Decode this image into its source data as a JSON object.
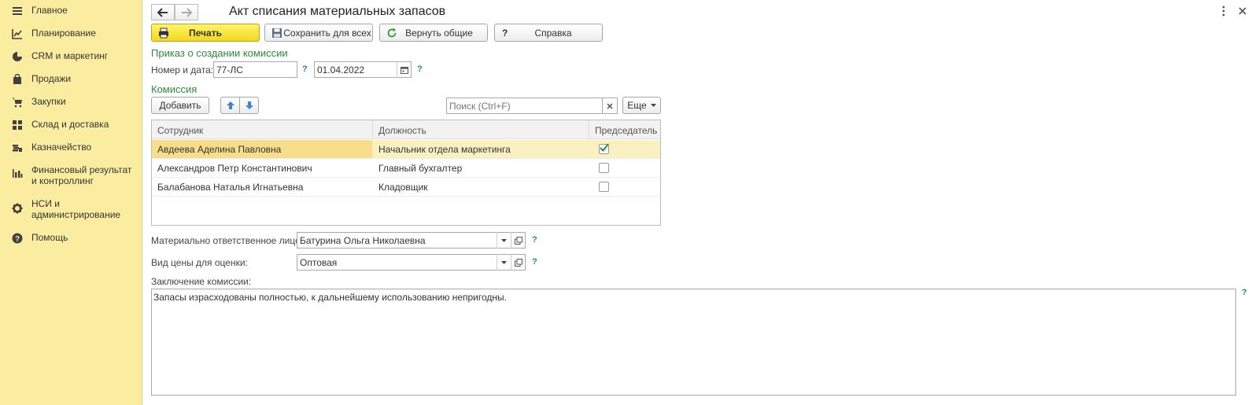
{
  "sidebar": {
    "items": [
      {
        "label": "Главное",
        "icon": "menu-icon"
      },
      {
        "label": "Планирование",
        "icon": "chart-line-icon"
      },
      {
        "label": "CRM и маркетинг",
        "icon": "pie-icon"
      },
      {
        "label": "Продажи",
        "icon": "bag-icon"
      },
      {
        "label": "Закупки",
        "icon": "cart-icon"
      },
      {
        "label": "Склад и доставка",
        "icon": "grid-icon"
      },
      {
        "label": "Казначейство",
        "icon": "coins-icon"
      },
      {
        "label": "Финансовый результат и контроллинг",
        "icon": "bar-chart-icon"
      },
      {
        "label": "НСИ и администрирование",
        "icon": "gear-icon"
      },
      {
        "label": "Помощь",
        "icon": "help-icon"
      }
    ]
  },
  "header": {
    "title": "Акт списания материальных запасов",
    "more_icon": "more-vertical-icon",
    "close_icon": "close-icon"
  },
  "toolbar": {
    "print_label": "Печать",
    "save_all_label": "Сохранить для всех",
    "restore_label": "Вернуть общие",
    "help_mark": "?",
    "help_label": "Справка"
  },
  "order": {
    "section_title": "Приказ о создании комиссии",
    "number_date_label": "Номер и дата:",
    "number_value": "77-ЛС",
    "date_value": "01.04.2022",
    "help": "?"
  },
  "commission": {
    "section_title": "Комиссия",
    "add_label": "Добавить",
    "search_placeholder": "Поиск (Ctrl+F)",
    "more_label": "Еще",
    "columns": {
      "employee": "Сотрудник",
      "position": "Должность",
      "chairman": "Председатель"
    },
    "rows": [
      {
        "employee": "Авдеева Аделина Павловна",
        "position": "Начальник отдела маркетинга",
        "chairman": true
      },
      {
        "employee": "Александров Петр Константинович",
        "position": "Главный бухгалтер",
        "chairman": false
      },
      {
        "employee": "Балабанова Наталья Игнатьевна",
        "position": "Кладовщик",
        "chairman": false
      }
    ]
  },
  "responsible": {
    "label": "Материально ответственное лицо:",
    "value": "Батурина Ольга Николаевна",
    "help": "?"
  },
  "price_type": {
    "label": "Вид цены для оценки:",
    "value": "Оптовая",
    "help": "?"
  },
  "conclusion": {
    "label": "Заключение комиссии:",
    "value": "Запасы израсходованы полностью, к дальнейшему использованию непригодны.",
    "help": "?"
  },
  "colors": {
    "sidebar_bg": "#fbeda0",
    "accent_green": "#2e8b3a",
    "print_button": "#f4d81e",
    "selected_row": "#fbf1c0",
    "help_blue": "#2a7ac0"
  }
}
